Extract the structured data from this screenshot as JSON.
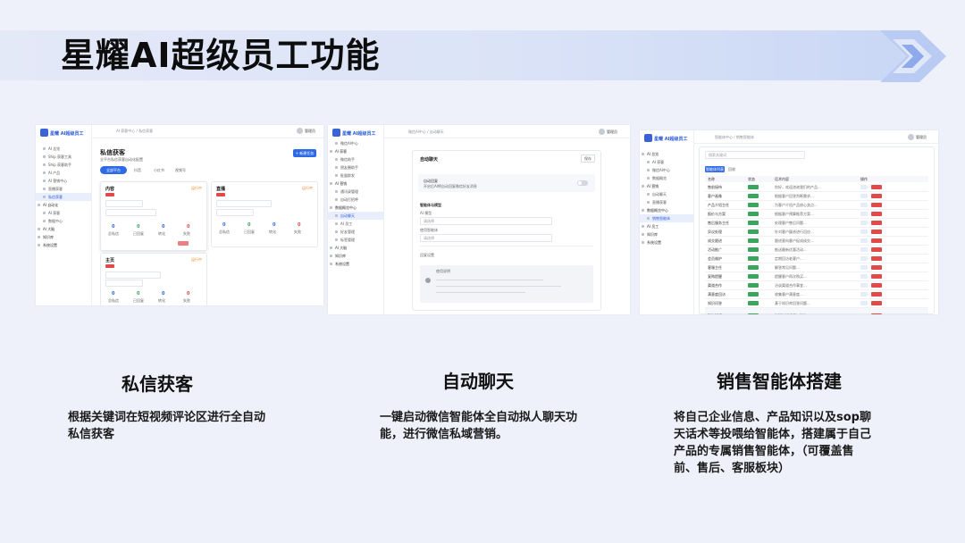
{
  "slide": {
    "title": "星耀AI超级员工功能"
  },
  "app": {
    "brand": "星耀 AI超级员工",
    "user": "管理员"
  },
  "features": [
    {
      "heading": "私信获客",
      "description": "根据关键词在短视频评论区进行全自动私信获客"
    },
    {
      "heading": "自动聊天",
      "description": "一键启动微信智能体全自动拟人聊天功能，进行微信私域营销。"
    },
    {
      "heading": "销售智能体搭建",
      "description": "将自己企业信息、产品知识以及sop聊天话术等投喂给智能体，搭建属于自己产品的专属销售智能体，（可覆盖售前、售后、客服板块）"
    }
  ],
  "screen1": {
    "breadcrumb": "AI 获客中心 / 私信获客",
    "page_title": "私信获客",
    "page_sub": "全平台私信获客自动化配置",
    "new_button": "+ 新建任务",
    "tabs": [
      "全部平台",
      "抖音",
      "小红书",
      "视频号"
    ],
    "menu": [
      "AI 总览",
      "Ship 获客工具",
      "Ship 获客助手",
      "AI 产品",
      "AI 营销中心",
      "直播获客",
      "私信获客",
      "AI 自动化",
      "AI 获客",
      "数据中心",
      "AI 大脑",
      "知识库",
      "系统设置"
    ],
    "cards": [
      {
        "name": "内容",
        "status": "运行中",
        "stats": [
          "0",
          "0",
          "0",
          "0"
        ],
        "stat_labels": [
          "总私信",
          "已回复",
          "转化",
          "失败"
        ]
      },
      {
        "name": "直播",
        "status": "运行中",
        "stats": [
          "0",
          "0",
          "0",
          "0"
        ],
        "stat_labels": [
          "总私信",
          "已回复",
          "转化",
          "失败"
        ]
      },
      {
        "name": "主页",
        "status": "运行中",
        "stats": [
          "0",
          "0",
          "0",
          "0"
        ],
        "stat_labels": [
          "总私信",
          "已回复",
          "转化",
          "失败"
        ]
      }
    ]
  },
  "screen2": {
    "breadcrumb": "微信AI中心 / 自动聊天",
    "card_title": "自动聊天",
    "save_button": "保存",
    "toggle_label": "自动回复",
    "toggle_sub": "开启后AI将自动回复微信好友消息",
    "section_title": "智能体与模型",
    "field1": "AI 模型",
    "field1_value": "请选择",
    "field2": "使用智能体",
    "field2_value": "请选择",
    "extra_title": "回复设置",
    "note_title": "使用说明",
    "menu": [
      "微信AI中心",
      "AI 获客",
      "微信助手",
      "朋友圈助手",
      "批量群发",
      "AI 营销",
      "通讯录管理",
      "自动打招呼",
      "数据概览中心",
      "自动聊天",
      "AI 员工",
      "好友管理",
      "标签管理",
      "AI 大脑",
      "知识库",
      "系统设置"
    ]
  },
  "screen3": {
    "breadcrumb": "智能体中心 / 销售智能体",
    "search_placeholder": "搜索关键词",
    "tabs": [
      "智能体列表",
      "回收"
    ],
    "columns": [
      "名称",
      "状态",
      "话术内容",
      "操作"
    ],
    "rows": [
      {
        "name": "售前接待",
        "text": "你好，欢迎咨询我们的产品..."
      },
      {
        "name": "客户画像",
        "text": "根据客户回答判断需求..."
      },
      {
        "name": "产品介绍主任",
        "text": "为客户介绍产品核心卖点..."
      },
      {
        "name": "报价与方案",
        "text": "根据客户预算推荐方案..."
      },
      {
        "name": "售后服务主任",
        "text": "处理客户售后问题..."
      },
      {
        "name": "异议处理",
        "text": "针对客户疑虑进行回应..."
      },
      {
        "name": "成交跟进",
        "text": "跟进意向客户促成成交..."
      },
      {
        "name": "活动推广",
        "text": "推送最新优惠活动..."
      },
      {
        "name": "会员维护",
        "text": "定期回访老客户..."
      },
      {
        "name": "客服主任",
        "text": "解答常见问题..."
      },
      {
        "name": "复购提醒",
        "text": "提醒客户再次购买..."
      },
      {
        "name": "渠道合作",
        "text": "洽谈渠道合作事宜..."
      },
      {
        "name": "满意度回访",
        "text": "收集客户满意度..."
      },
      {
        "name": "知识问答",
        "text": "基于知识库回答问题..."
      },
      {
        "name": "投诉处理",
        "text": "安抚并处理客户投诉..."
      }
    ],
    "menu": [
      "AI 总览",
      "AI 获客",
      "微信AI中心",
      "数据概览",
      "AI 营销",
      "自动聊天",
      "直播获客",
      "数据概览中心",
      "销售智能体",
      "AI 员工",
      "知识库",
      "系统设置"
    ]
  }
}
